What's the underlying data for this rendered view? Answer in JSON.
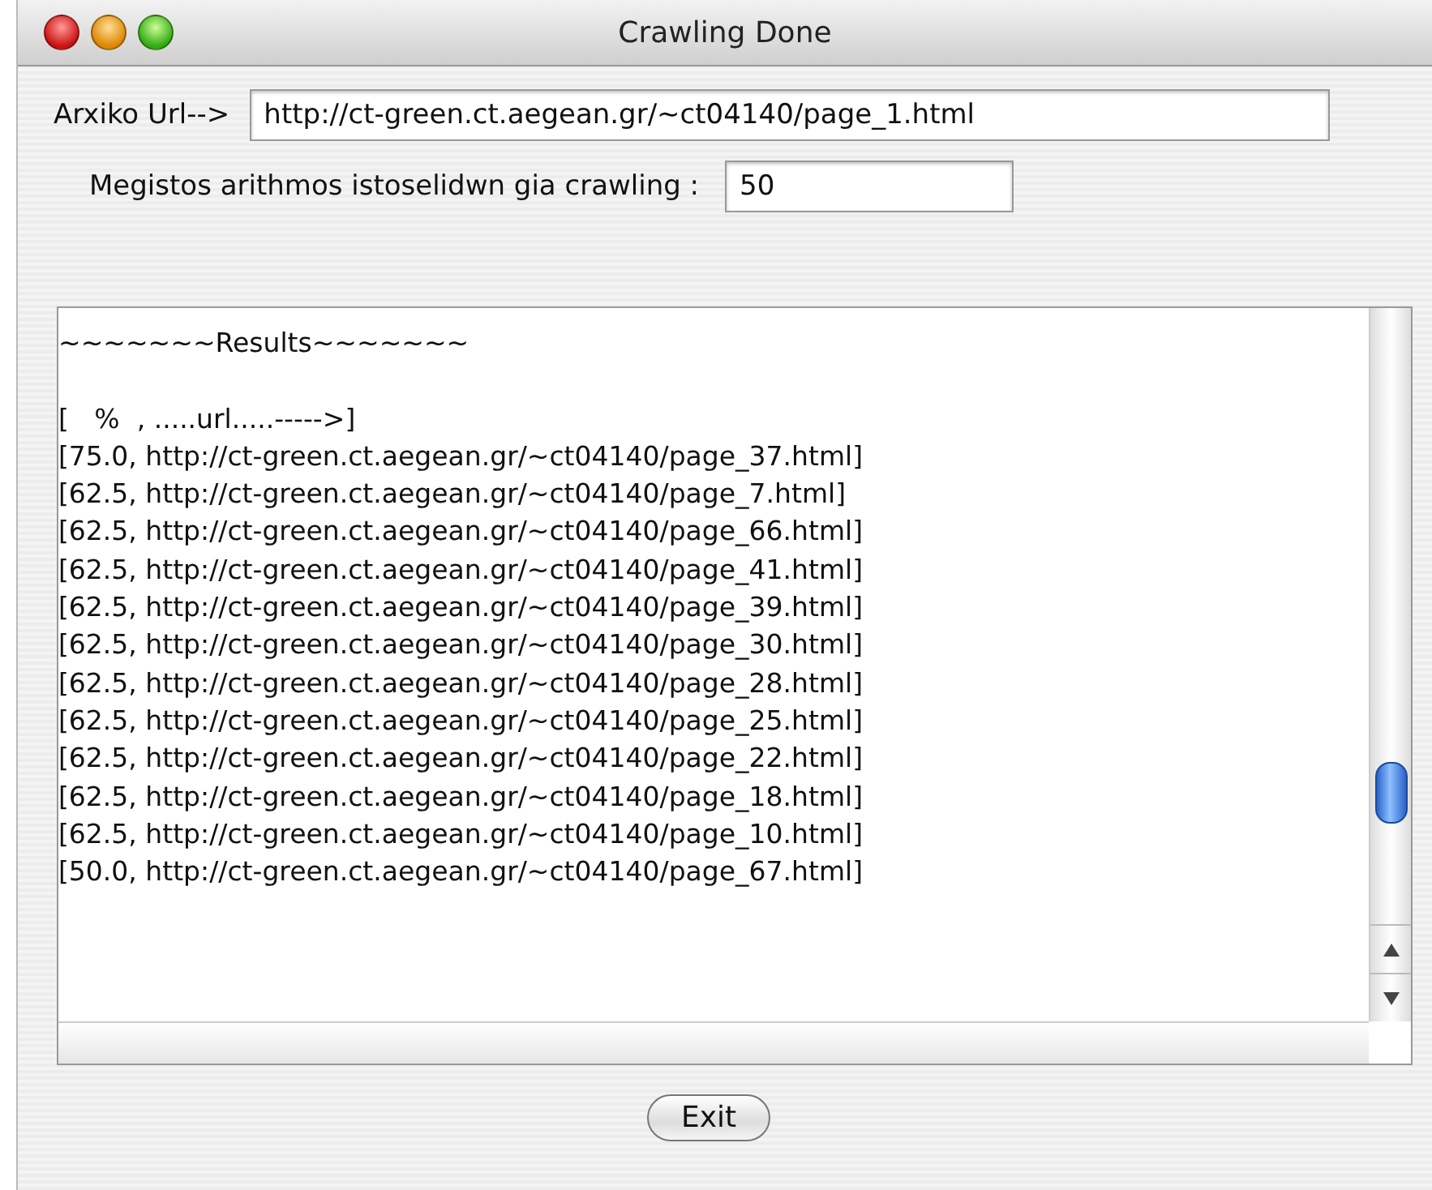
{
  "window": {
    "title": "Crawling Done"
  },
  "start_url": {
    "label": "Arxiko Url-->",
    "value": "http://ct-green.ct.aegean.gr/~ct04140/page_1.html"
  },
  "max_pages": {
    "label": "Megistos arithmos istoselidwn gia crawling :",
    "value": "50"
  },
  "results": {
    "title": "~~~~~~~Results~~~~~~~",
    "header": "[   %  , .....url.....----->]",
    "rows": [
      "[75.0, http://ct-green.ct.aegean.gr/~ct04140/page_37.html]",
      "[62.5, http://ct-green.ct.aegean.gr/~ct04140/page_7.html]",
      "[62.5, http://ct-green.ct.aegean.gr/~ct04140/page_66.html]",
      "[62.5, http://ct-green.ct.aegean.gr/~ct04140/page_41.html]",
      "[62.5, http://ct-green.ct.aegean.gr/~ct04140/page_39.html]",
      "[62.5, http://ct-green.ct.aegean.gr/~ct04140/page_30.html]",
      "[62.5, http://ct-green.ct.aegean.gr/~ct04140/page_28.html]",
      "[62.5, http://ct-green.ct.aegean.gr/~ct04140/page_25.html]",
      "[62.5, http://ct-green.ct.aegean.gr/~ct04140/page_22.html]",
      "[62.5, http://ct-green.ct.aegean.gr/~ct04140/page_18.html]",
      "[62.5, http://ct-green.ct.aegean.gr/~ct04140/page_10.html]",
      "[50.0, http://ct-green.ct.aegean.gr/~ct04140/page_67.html]"
    ]
  },
  "buttons": [
    "Exit"
  ]
}
